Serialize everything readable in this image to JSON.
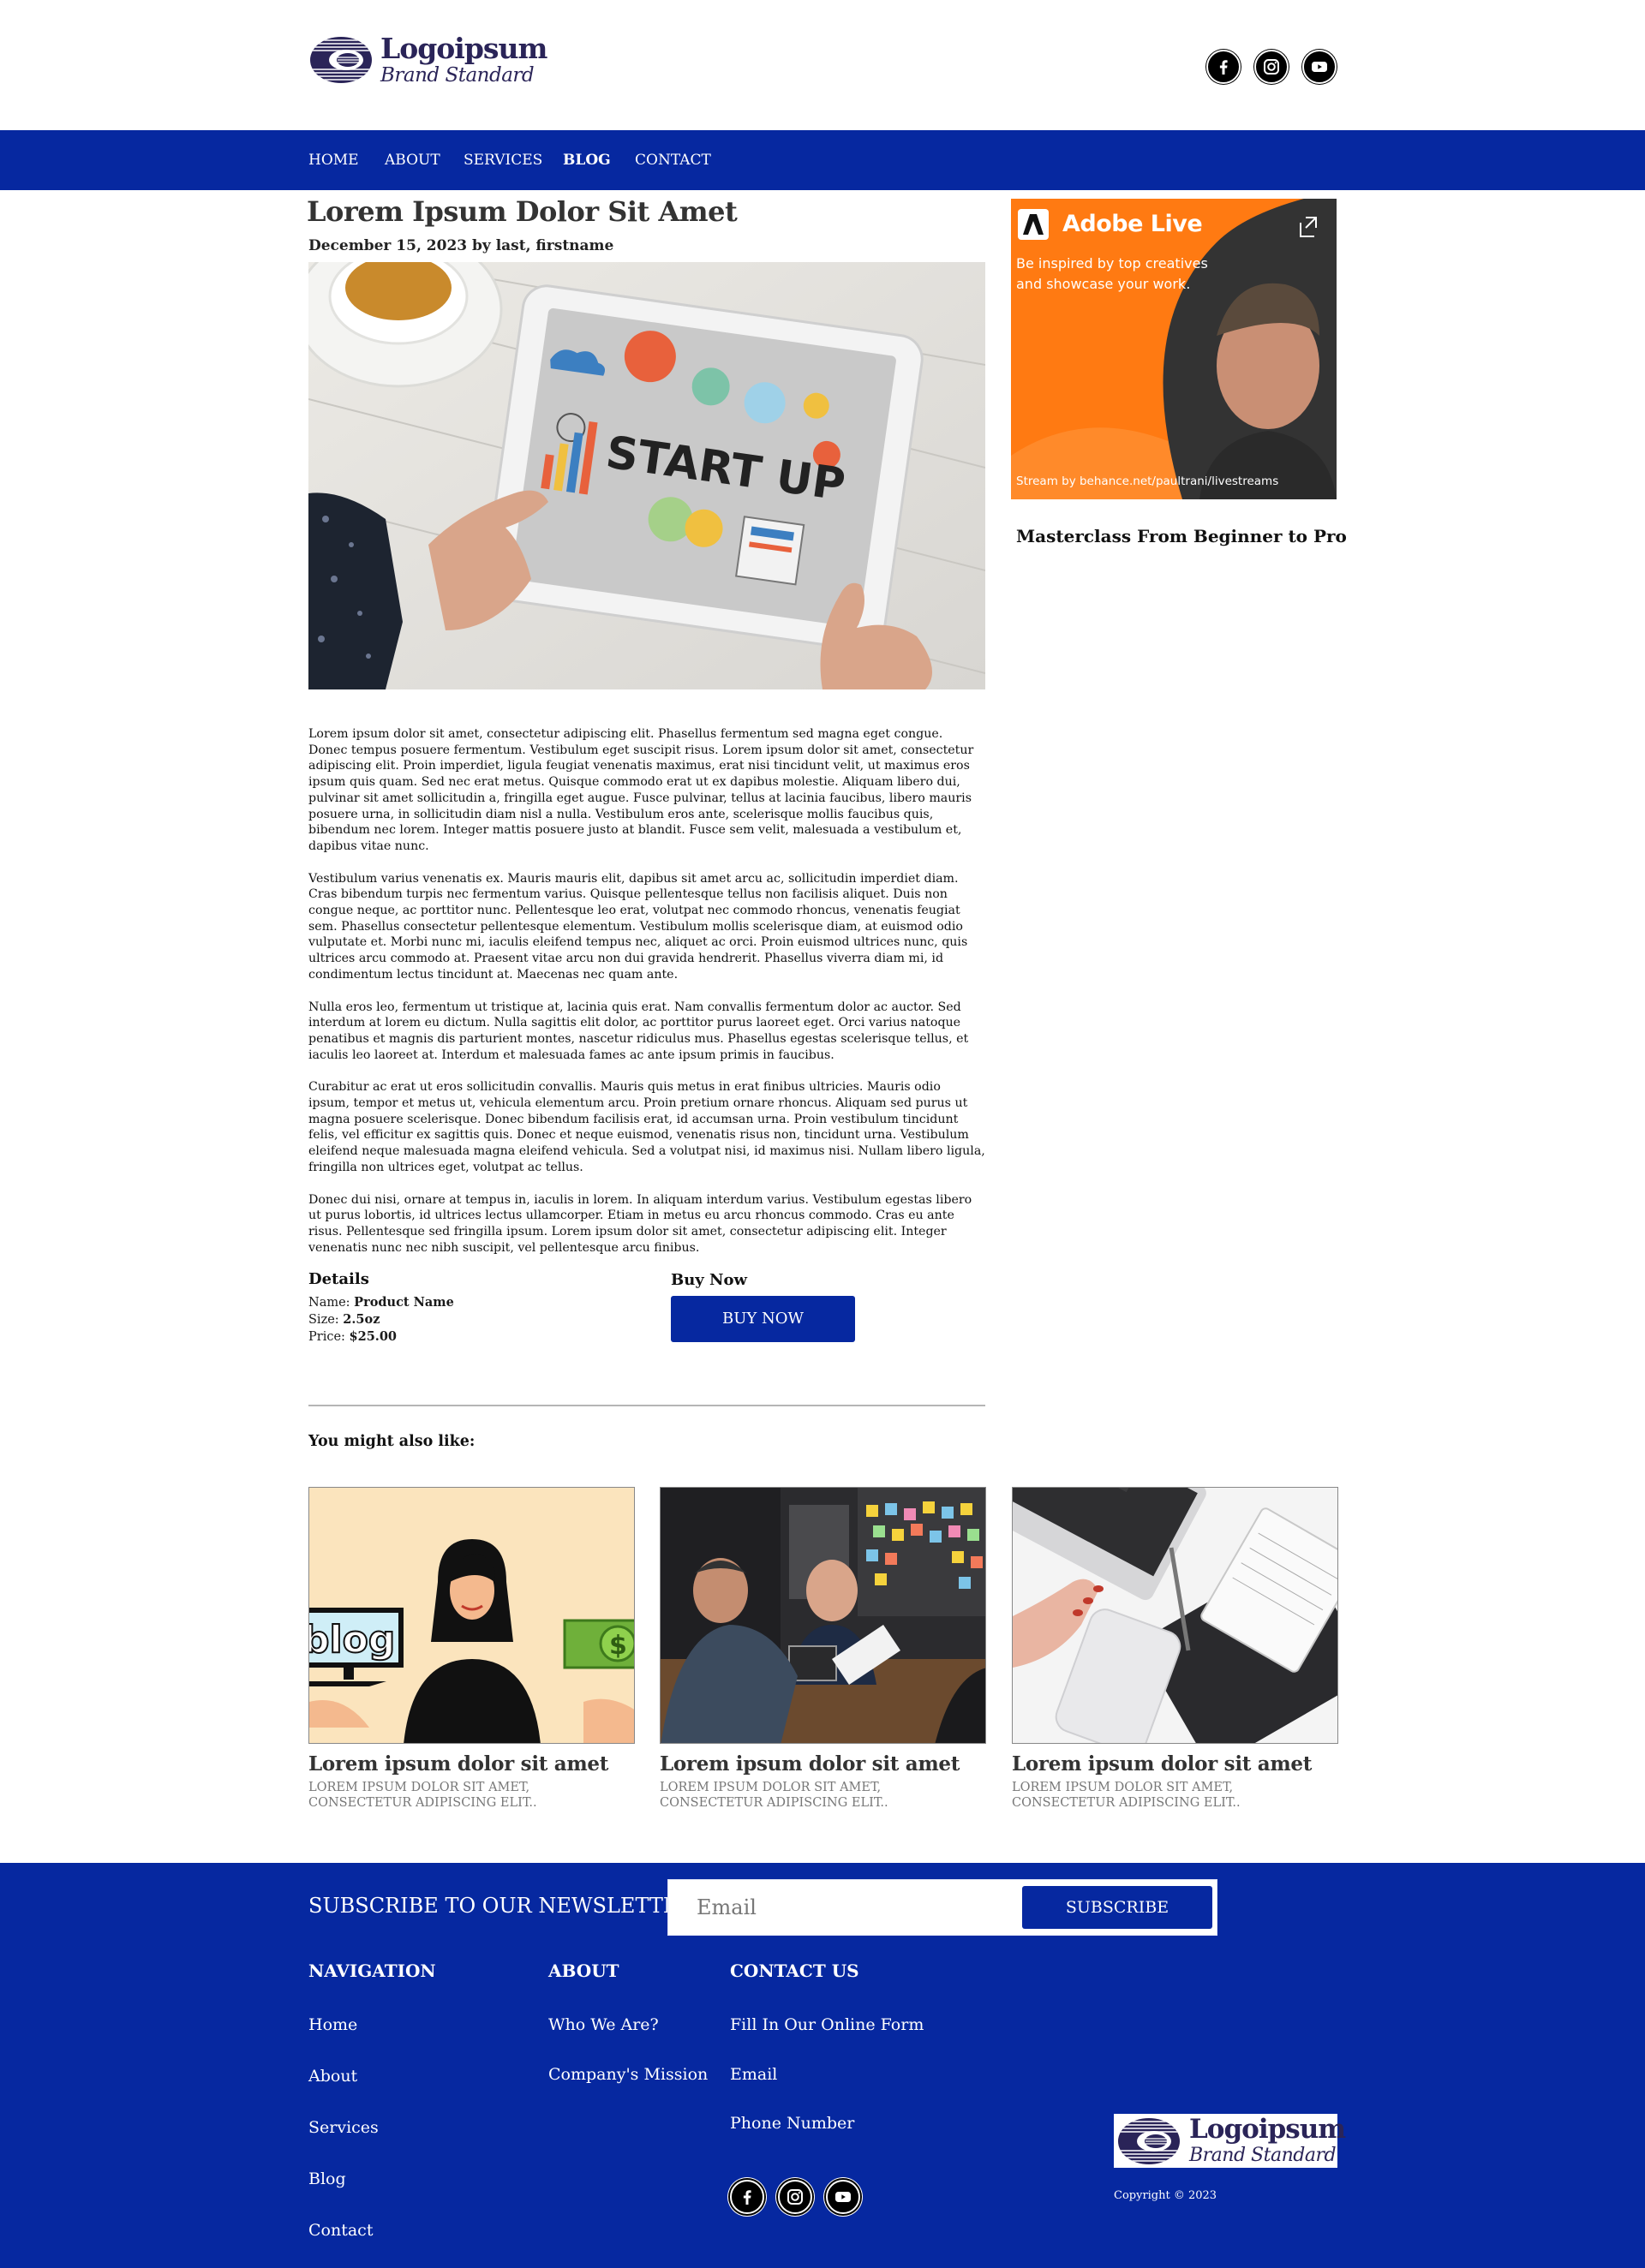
{
  "brand": {
    "name": "Logoipsum",
    "tagline": "Brand Standard",
    "color": "#2a2458"
  },
  "colors": {
    "primary": "#0628a0",
    "ad_orange": "#ff7a12"
  },
  "nav": {
    "items": [
      {
        "label": "HOME",
        "active": false
      },
      {
        "label": "ABOUT",
        "active": false
      },
      {
        "label": "SERVICES",
        "active": false
      },
      {
        "label": "BLOG",
        "active": true
      },
      {
        "label": "CONTACT",
        "active": false
      }
    ]
  },
  "social_icons": [
    "facebook-icon",
    "instagram-icon",
    "youtube-icon"
  ],
  "article": {
    "title": "Lorem Ipsum Dolor Sit Amet",
    "meta": "December 15, 2023 by last, firstname",
    "hero_text": "START UP",
    "paragraphs": [
      "Lorem ipsum dolor sit amet, consectetur adipiscing elit. Phasellus fermentum sed magna eget congue. Donec tempus posuere fermentum. Vestibulum eget suscipit risus. Lorem ipsum dolor sit amet, consectetur adipiscing elit. Proin imperdiet, ligula feugiat venenatis maximus, erat nisi tincidunt velit, ut maximus eros ipsum quis quam. Sed nec erat metus. Quisque commodo erat ut ex dapibus molestie. Aliquam libero dui, pulvinar sit amet sollicitudin a, fringilla eget augue. Fusce pulvinar, tellus at lacinia faucibus, libero mauris posuere urna, in sollicitudin diam nisl a nulla. Vestibulum eros ante, scelerisque mollis faucibus quis, bibendum nec lorem. Integer mattis posuere justo at blandit. Fusce sem velit, malesuada a vestibulum et, dapibus vitae nunc.",
      "Vestibulum varius venenatis ex. Mauris mauris elit, dapibus sit amet arcu ac, sollicitudin imperdiet diam. Cras bibendum turpis nec fermentum varius. Quisque pellentesque tellus non facilisis aliquet. Duis non congue neque, ac porttitor nunc. Pellentesque leo erat, volutpat nec commodo rhoncus, venenatis feugiat sem. Phasellus consectetur pellentesque elementum. Vestibulum mollis scelerisque diam, at euismod odio vulputate et. Morbi nunc mi, iaculis eleifend tempus nec, aliquet ac orci. Proin euismod ultrices nunc, quis ultrices arcu commodo at. Praesent vitae arcu non dui gravida hendrerit. Phasellus viverra diam mi, id condimentum lectus tincidunt at. Maecenas nec quam ante.",
      "Nulla eros leo, fermentum ut tristique at, lacinia quis erat. Nam convallis fermentum dolor ac auctor. Sed interdum at lorem eu dictum. Nulla sagittis elit dolor, ac porttitor purus laoreet eget. Orci varius natoque penatibus et magnis dis parturient montes, nascetur ridiculus mus. Phasellus egestas scelerisque tellus, et iaculis leo laoreet at. Interdum et malesuada fames ac ante ipsum primis in faucibus.",
      "Curabitur ac erat ut eros sollicitudin convallis. Mauris quis metus in erat finibus ultricies. Mauris odio ipsum, tempor et metus ut, vehicula elementum arcu. Proin pretium ornare rhoncus. Aliquam sed purus ut magna posuere scelerisque. Donec bibendum facilisis erat, id accumsan urna. Proin vestibulum tincidunt felis, vel efficitur ex sagittis quis. Donec et neque euismod, venenatis risus non, tincidunt urna. Vestibulum eleifend neque malesuada magna eleifend vehicula. Sed a volutpat nisi, id maximus nisi. Nullam libero ligula, fringilla non ultrices eget, volutpat ac tellus.",
      "Donec dui nisi, ornare at tempus in, iaculis in lorem. In aliquam interdum varius. Vestibulum egestas libero ut purus lobortis, id ultrices lectus ullamcorper. Etiam in metus eu arcu rhoncus commodo. Cras eu ante risus. Pellentesque sed fringilla ipsum. Lorem ipsum dolor sit amet, consectetur adipiscing elit. Integer venenatis nunc nec nibh suscipit, vel pellentesque arcu finibus."
    ]
  },
  "details": {
    "heading": "Details",
    "name_label": "Name:",
    "name_value": "Product Name",
    "size_label": "Size:",
    "size_value": "2.5oz",
    "price_label": "Price:",
    "price_value": "$25.00"
  },
  "buy": {
    "heading": "Buy Now",
    "button_label": "BUY NOW"
  },
  "related": {
    "heading": "You might also like:",
    "cards": [
      {
        "title": "Lorem ipsum dolor sit amet",
        "desc": "LOREM IPSUM DOLOR SIT AMET, CONSECTETUR ADIPISCING ELIT..",
        "image_text": "blog",
        "image_symbol": "$"
      },
      {
        "title": "Lorem ipsum dolor sit amet",
        "desc": "LOREM IPSUM DOLOR SIT AMET, CONSECTETUR ADIPISCING ELIT.."
      },
      {
        "title": "Lorem ipsum dolor sit amet",
        "desc": "LOREM IPSUM DOLOR SIT AMET, CONSECTETUR ADIPISCING ELIT.."
      }
    ]
  },
  "ad": {
    "brand": "Adobe Live",
    "tagline": "Be inspired by top creatives and showcase your work.",
    "footer_text": "Stream by behance.net/paultrani/livestreams",
    "caption": "Masterclass From Beginner to Pro"
  },
  "footer": {
    "newsletter_label": "SUBSCRIBE TO OUR NEWSLETTER:",
    "email_placeholder": "Email",
    "subscribe_label": "SUBSCRIBE",
    "nav_heading": "NAVIGATION",
    "nav_links": [
      "Home",
      "About",
      "Services",
      "Blog",
      "Contact"
    ],
    "about_heading": "ABOUT",
    "about_links": [
      "Who We Are?",
      "Company's Mission"
    ],
    "contact_heading": "CONTACT US",
    "contact_links": [
      "Fill In Our Online Form",
      "Email",
      "Phone Number"
    ],
    "copyright": "Copyright © 2023"
  }
}
